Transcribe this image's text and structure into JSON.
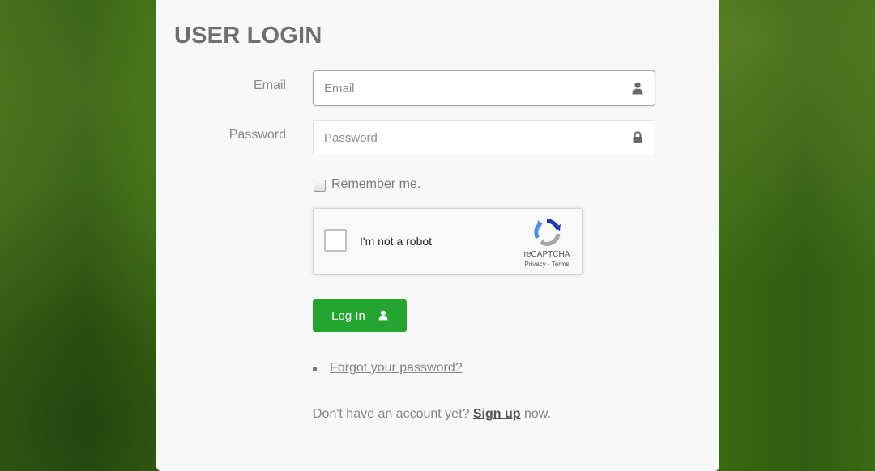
{
  "login": {
    "title": "USER LOGIN",
    "email_label": "Email",
    "email_placeholder": "Email",
    "email_value": "",
    "password_label": "Password",
    "password_placeholder": "Password",
    "password_value": "",
    "remember_label": "Remember me.",
    "remember_checked": false,
    "login_button": "Log In",
    "forgot_link": "Forgot your password?",
    "signup_prefix": "Don't have an account yet?",
    "signup_link": "Sign up",
    "signup_suffix": "now."
  },
  "recaptcha": {
    "checkbox_label": "I'm not a robot",
    "brand": "reCAPTCHA",
    "privacy_link": "Privacy",
    "separator": "-",
    "terms_link": "Terms"
  },
  "icons": {
    "email_field": "user-icon",
    "password_field": "lock-icon",
    "login_button": "user-icon",
    "recaptcha": "recaptcha-logo"
  },
  "colors": {
    "panel_background": "#f8f8f8",
    "login_button": "#23a530",
    "background": "#3a6a12"
  }
}
